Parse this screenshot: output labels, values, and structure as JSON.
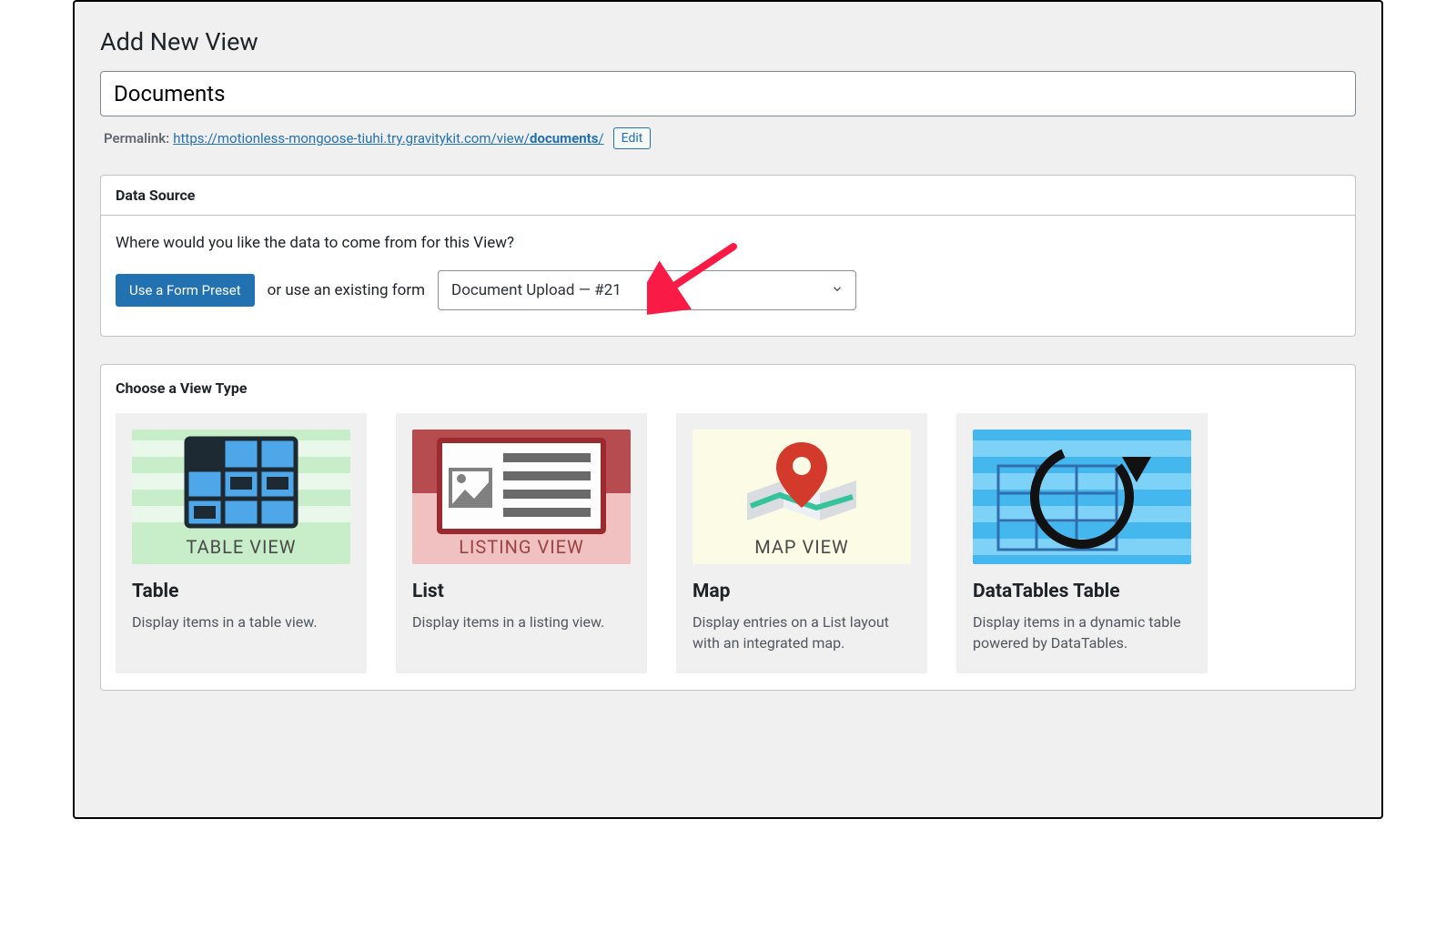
{
  "page_title": "Add New View",
  "title_value": "Documents",
  "permalink": {
    "label": "Permalink:",
    "url_prefix": "https://motionless-mongoose-tiuhi.try.gravitykit.com/view/",
    "slug": "documents",
    "suffix": "/",
    "edit_label": "Edit"
  },
  "data_source": {
    "heading": "Data Source",
    "prompt": "Where would you like the data to come from for this View?",
    "preset_button": "Use a Form Preset",
    "or_text": "or use an existing form",
    "selected_form": "Document Upload — #21"
  },
  "view_type": {
    "heading": "Choose a View Type",
    "options": [
      {
        "title": "Table",
        "desc": "Display items in a table view.",
        "thumb_label": "TABLE VIEW"
      },
      {
        "title": "List",
        "desc": "Display items in a listing view.",
        "thumb_label": "LISTING VIEW"
      },
      {
        "title": "Map",
        "desc": "Display entries on a List layout with an integrated map.",
        "thumb_label": "MAP VIEW"
      },
      {
        "title": "DataTables Table",
        "desc": "Display items in a dynamic table powered by DataTables.",
        "thumb_label": ""
      }
    ]
  }
}
